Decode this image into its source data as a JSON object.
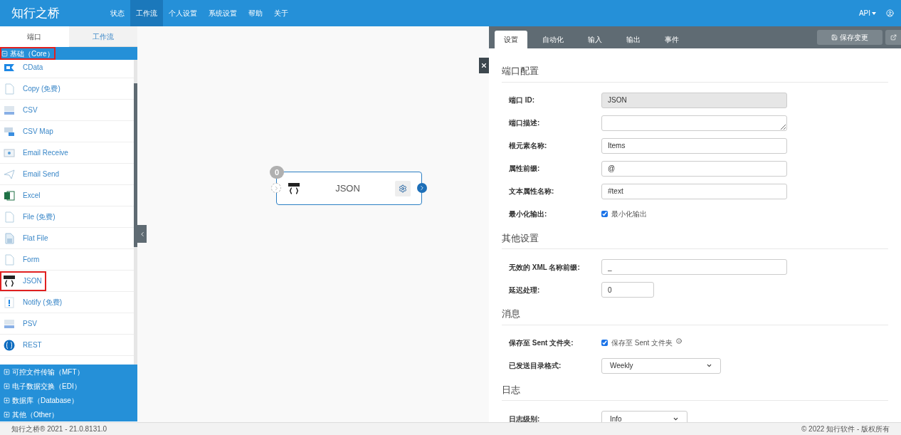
{
  "header": {
    "logo": "知行之桥",
    "nav": [
      {
        "label": "状态",
        "selected": false
      },
      {
        "label": "工作流",
        "selected": true
      },
      {
        "label": "个人设置",
        "selected": false
      },
      {
        "label": "系统设置",
        "selected": false
      },
      {
        "label": "帮助",
        "selected": false
      },
      {
        "label": "关于",
        "selected": false
      }
    ],
    "api_menu": "API"
  },
  "sidebar": {
    "tabs": [
      {
        "label": "端口",
        "selected": true
      },
      {
        "label": "工作流",
        "selected": false
      }
    ],
    "groups": [
      {
        "label": "基础（Core）",
        "expanded": true,
        "highlighted": true,
        "items": [
          {
            "label": "CData",
            "kind": "cdata",
            "highlighted": false
          },
          {
            "label": "Copy (免费)",
            "kind": "doc",
            "highlighted": false
          },
          {
            "label": "CSV",
            "kind": "csv",
            "highlighted": false
          },
          {
            "label": "CSV Map",
            "kind": "map",
            "highlighted": false
          },
          {
            "label": "Email Receive",
            "kind": "receive",
            "highlighted": false
          },
          {
            "label": "Email Send",
            "kind": "send",
            "highlighted": false
          },
          {
            "label": "Excel",
            "kind": "excel",
            "highlighted": false
          },
          {
            "label": "File (免费)",
            "kind": "doc",
            "highlighted": false
          },
          {
            "label": "Flat File",
            "kind": "flat",
            "highlighted": false
          },
          {
            "label": "Form",
            "kind": "doc",
            "highlighted": false
          },
          {
            "label": "JSON",
            "kind": "json",
            "highlighted": true
          },
          {
            "label": "Notify (免费)",
            "kind": "notify",
            "highlighted": false
          },
          {
            "label": "PSV",
            "kind": "csv",
            "highlighted": false
          },
          {
            "label": "REST",
            "kind": "rest",
            "highlighted": false
          }
        ]
      },
      {
        "label": "可控文件传输（MFT）",
        "expanded": false,
        "highlighted": false
      },
      {
        "label": "电子数据交换（EDI）",
        "expanded": false,
        "highlighted": false
      },
      {
        "label": "数据库（Database）",
        "expanded": false,
        "highlighted": false
      },
      {
        "label": "其他（Other）",
        "expanded": false,
        "highlighted": false
      }
    ]
  },
  "canvas": {
    "node": {
      "title": "JSON",
      "badge": "0"
    }
  },
  "panel": {
    "tabs": [
      {
        "label": "设置",
        "selected": true
      },
      {
        "label": "自动化",
        "selected": false
      },
      {
        "label": "输入",
        "selected": false
      },
      {
        "label": "输出",
        "selected": false
      },
      {
        "label": "事件",
        "selected": false
      }
    ],
    "save_button": "保存变更",
    "sections": [
      {
        "title": "端口配置",
        "fields": [
          {
            "kind": "text",
            "label": "端口 ID:",
            "value": "JSON",
            "disabled": true
          },
          {
            "kind": "textarea",
            "label": "端口描述:",
            "disabled": false
          },
          {
            "kind": "text",
            "label": "根元素名称:",
            "value": "Items",
            "disabled": false
          },
          {
            "kind": "text",
            "label": "属性前缀:",
            "value": "@",
            "disabled": false
          },
          {
            "kind": "text",
            "label": "文本属性名称:",
            "value": "#text",
            "disabled": false
          },
          {
            "kind": "checkbox",
            "label": "最小化输出:",
            "option": "最小化输出",
            "checked": true,
            "info": false
          }
        ]
      },
      {
        "title": "其他设置",
        "fields": [
          {
            "kind": "text",
            "label": "无效的 XML 名称前缀:",
            "value": "_",
            "disabled": false
          },
          {
            "kind": "text",
            "label": "延迟处理:",
            "value": "0",
            "disabled": false
          }
        ]
      },
      {
        "title": "消息",
        "fields": [
          {
            "kind": "checkbox",
            "label": "保存至 Sent 文件夹:",
            "option": "保存至 Sent 文件夹",
            "checked": true,
            "info": true
          },
          {
            "kind": "select",
            "label": "已发送目录格式:",
            "value": "Weekly"
          }
        ]
      },
      {
        "title": "日志",
        "fields": [
          {
            "kind": "select",
            "label": "日志级别:",
            "value": "Info"
          }
        ]
      }
    ]
  },
  "footer": {
    "version": "知行之桥® 2021 - 21.0.8131.0",
    "copyright": "© 2022 知行软件 - 版权所有"
  }
}
